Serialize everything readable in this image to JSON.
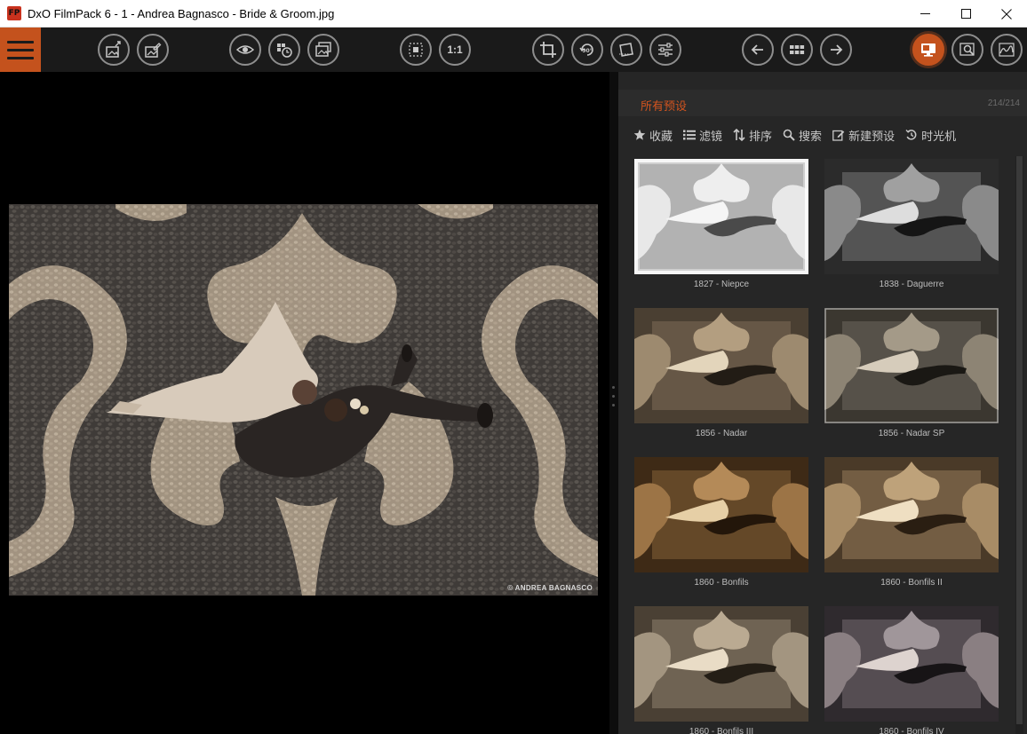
{
  "window": {
    "app_icon_text": "FP",
    "title": "DxO FilmPack 6 - 1 - Andrea Bagnasco - Bride & Groom.jpg"
  },
  "toolbar": {
    "one_to_one_label": "1:1",
    "rotate_label": "90°",
    "accent_color": "#c4521d"
  },
  "viewer": {
    "photo_credit": "© ANDREA BAGNASCO"
  },
  "panel": {
    "title": "所有预设",
    "count": "214/214",
    "tools": {
      "favorites": "收藏",
      "filter": "滤镜",
      "sort": "排序",
      "search": "搜索",
      "new_preset": "新建预设",
      "time_machine": "时光机"
    },
    "presets": [
      {
        "label": "1827 - Niepce",
        "tone": "niepce"
      },
      {
        "label": "1838 - Daguerre",
        "tone": "daguerre"
      },
      {
        "label": "1856 - Nadar",
        "tone": "nadar"
      },
      {
        "label": "1856 - Nadar SP",
        "tone": "nadarsp"
      },
      {
        "label": "1860 - Bonfils",
        "tone": "bonfils"
      },
      {
        "label": "1860 - Bonfils II",
        "tone": "bonfils2"
      },
      {
        "label": "1860 - Bonfils III",
        "tone": "bonfils3"
      },
      {
        "label": "1860 - Bonfils IV",
        "tone": "bonfils4"
      }
    ]
  }
}
